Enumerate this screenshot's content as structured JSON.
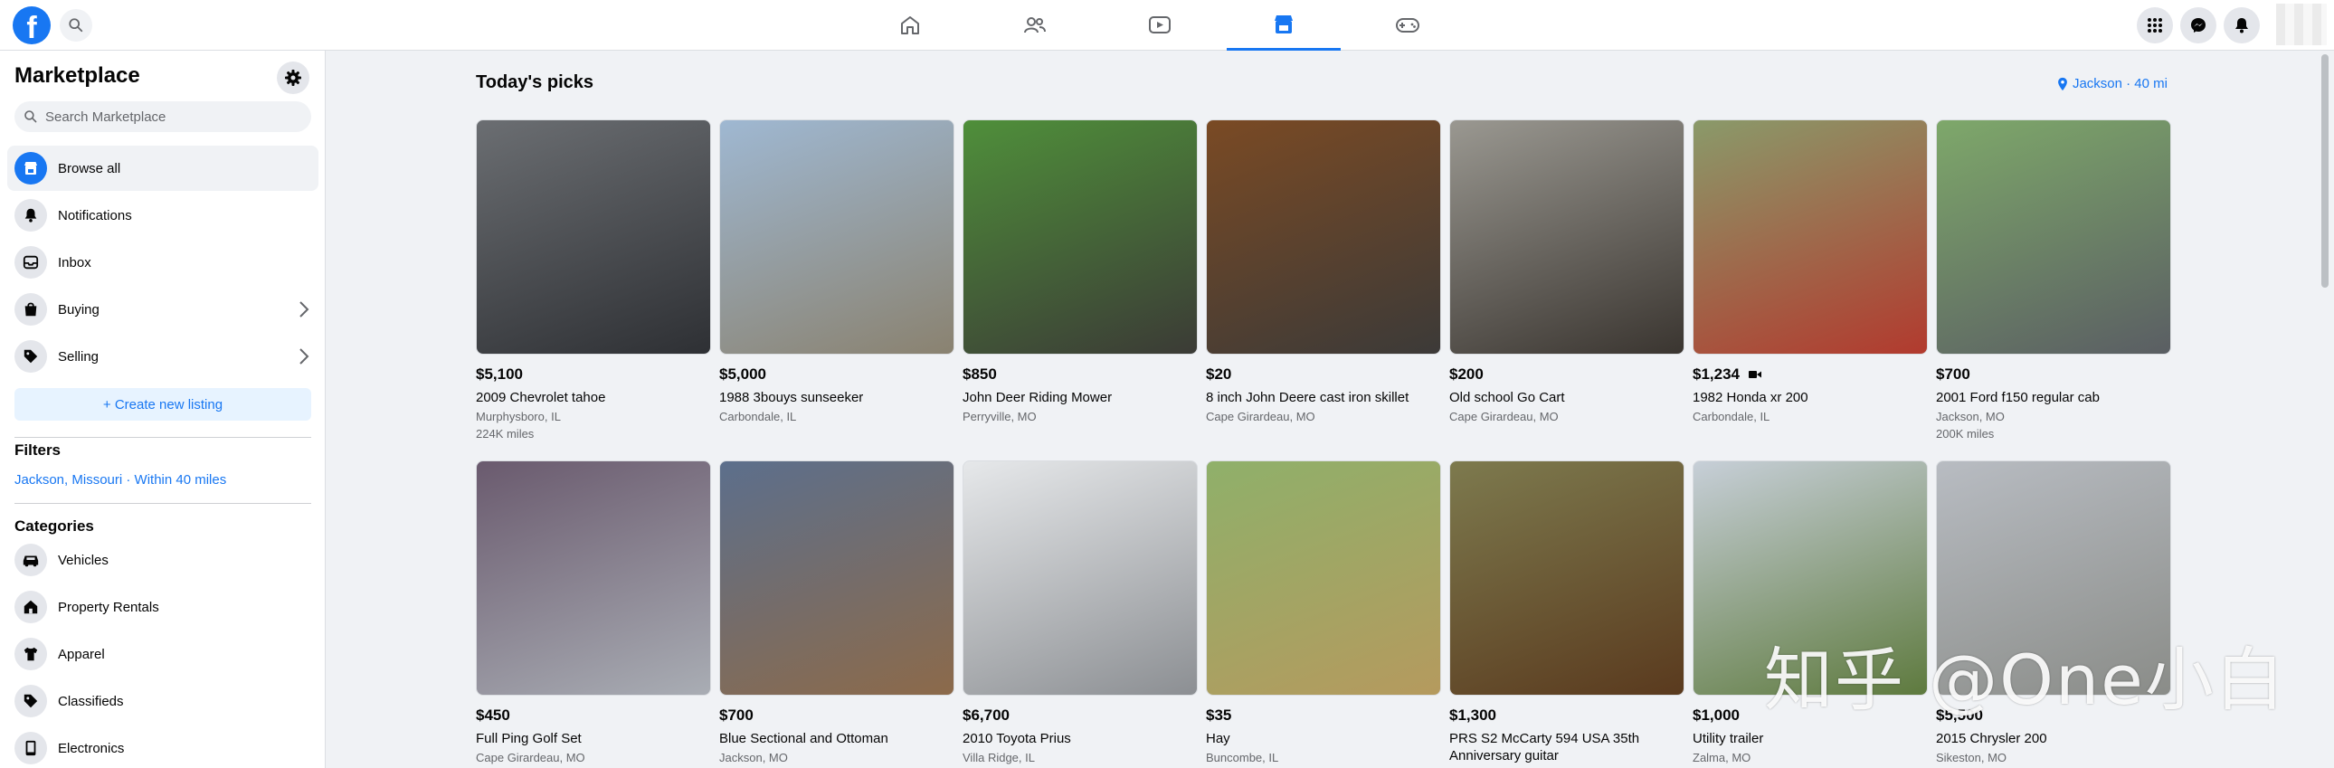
{
  "header": {
    "logo_letter": "f",
    "nav": [
      {
        "name": "home-icon"
      },
      {
        "name": "friends-icon"
      },
      {
        "name": "watch-icon"
      },
      {
        "name": "marketplace-icon",
        "active": true
      },
      {
        "name": "gaming-icon"
      }
    ],
    "right_buttons": [
      "menu-grid-icon",
      "messenger-icon",
      "bell-icon"
    ]
  },
  "sidebar": {
    "title": "Marketplace",
    "search_placeholder": "Search Marketplace",
    "items": [
      {
        "label": "Browse all",
        "icon": "storefront-icon",
        "active": true
      },
      {
        "label": "Notifications",
        "icon": "bell-icon"
      },
      {
        "label": "Inbox",
        "icon": "inbox-icon"
      },
      {
        "label": "Buying",
        "icon": "shopping-bag-icon",
        "chevron": true
      },
      {
        "label": "Selling",
        "icon": "tag-icon",
        "chevron": true
      }
    ],
    "create_label": "+ Create new listing",
    "filters_heading": "Filters",
    "filter_value": "Jackson, Missouri · Within 40 miles",
    "categories_heading": "Categories",
    "categories": [
      {
        "label": "Vehicles",
        "icon": "car-icon"
      },
      {
        "label": "Property Rentals",
        "icon": "house-icon"
      },
      {
        "label": "Apparel",
        "icon": "shirt-icon"
      },
      {
        "label": "Classifieds",
        "icon": "tag-icon"
      },
      {
        "label": "Electronics",
        "icon": "phone-icon"
      }
    ]
  },
  "main": {
    "title": "Today's picks",
    "location": "Jackson · 40 mi",
    "listings": [
      {
        "price": "$5,100",
        "title": "2009 Chevrolet tahoe",
        "location": "Murphysboro, IL",
        "miles": "224K miles",
        "colors": [
          "#6b6e72",
          "#2e3034"
        ]
      },
      {
        "price": "$5,000",
        "title": "1988 3bouys sunseeker",
        "location": "Carbondale, IL",
        "miles": "",
        "colors": [
          "#9fb8d2",
          "#8a8270"
        ]
      },
      {
        "price": "$850",
        "title": "John Deer Riding Mower",
        "location": "Perryville, MO",
        "miles": "",
        "colors": [
          "#4f8f3a",
          "#3b3b36"
        ]
      },
      {
        "price": "$20",
        "title": "8 inch John Deere cast iron skillet",
        "location": "Cape Girardeau, MO",
        "miles": "",
        "colors": [
          "#7a4a24",
          "#3c3a38"
        ]
      },
      {
        "price": "$200",
        "title": "Old school Go Cart",
        "location": "Cape Girardeau, MO",
        "miles": "",
        "colors": [
          "#9a9891",
          "#3a3530"
        ]
      },
      {
        "price": "$1,234",
        "title": "1982 Honda xr 200",
        "location": "Carbondale, IL",
        "miles": "",
        "colors": [
          "#8a9a6a",
          "#b23a2e"
        ]
      },
      {
        "price": "$700",
        "title": "2001 Ford f150 regular cab",
        "location": "Jackson, MO",
        "miles": "200K miles",
        "colors": [
          "#7ea86a",
          "#5a5e63"
        ]
      },
      {
        "price": "$450",
        "title": "Full Ping Golf Set",
        "location": "Cape Girardeau, MO",
        "miles": "",
        "colors": [
          "#6a5a6e",
          "#a9adb4"
        ]
      },
      {
        "price": "$700",
        "title": "Blue Sectional and Ottoman",
        "location": "Jackson, MO",
        "miles": "",
        "colors": [
          "#5c6f8c",
          "#8c6a4a"
        ]
      },
      {
        "price": "$6,700",
        "title": "2010 Toyota Prius",
        "location": "Villa Ridge, IL",
        "miles": "",
        "colors": [
          "#e6e8ea",
          "#8c8f93"
        ]
      },
      {
        "price": "$35",
        "title": "Hay",
        "location": "Buncombe, IL",
        "miles": "",
        "colors": [
          "#8fb06a",
          "#b59a5e"
        ]
      },
      {
        "price": "$1,300",
        "title": "PRS S2 McCarty 594 USA 35th Anniversary guitar",
        "location": "",
        "miles": "",
        "colors": [
          "#7d7a4e",
          "#5a3a1e"
        ]
      },
      {
        "price": "$1,000",
        "title": "Utility trailer",
        "location": "Zalma, MO",
        "miles": "",
        "colors": [
          "#c7cfd8",
          "#5e7a3e"
        ]
      },
      {
        "price": "$5,500",
        "title": "2015 Chrysler 200",
        "location": "Sikeston, MO",
        "miles": "",
        "colors": [
          "#b8bcc2",
          "#8a8c88"
        ]
      }
    ]
  },
  "watermark": "知乎 @One小白"
}
